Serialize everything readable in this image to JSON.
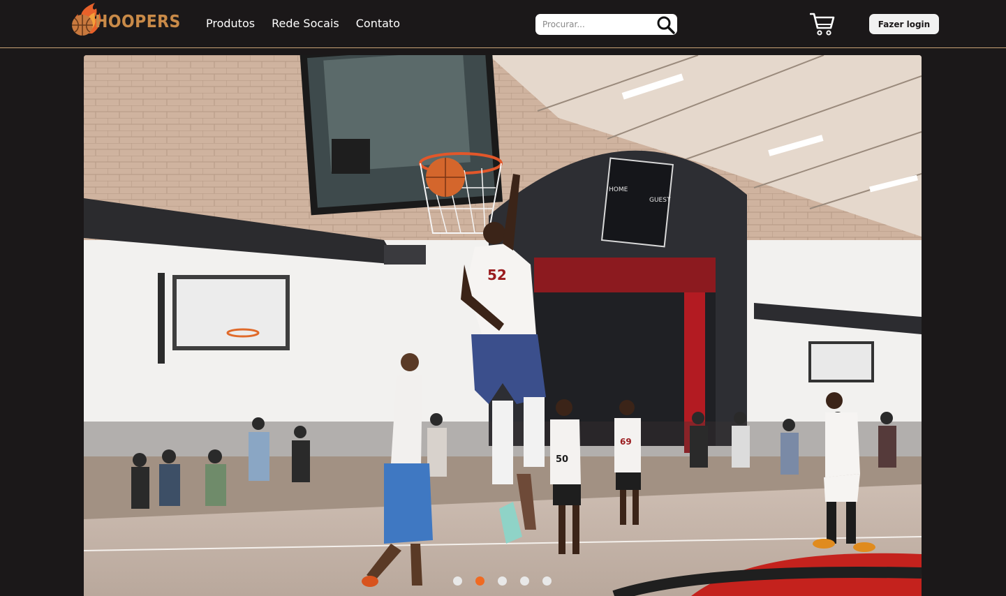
{
  "brand": {
    "name": "HOOPERS",
    "accent": "#c98a48"
  },
  "nav": {
    "items": [
      "Produtos",
      "Rede Socais",
      "Contato"
    ]
  },
  "search": {
    "placeholder": "Procurar...",
    "value": "",
    "icon": "search-icon"
  },
  "cart": {
    "icon": "cart-icon"
  },
  "login": {
    "label": "Fazer login"
  },
  "carousel": {
    "slide_count": 5,
    "active_index": 1,
    "active_color": "#f06a22",
    "scoreboard_home": "HOME",
    "scoreboard_guest": "GUEST",
    "jersey_main": "52",
    "jersey_b": "50",
    "jersey_c": "69"
  }
}
